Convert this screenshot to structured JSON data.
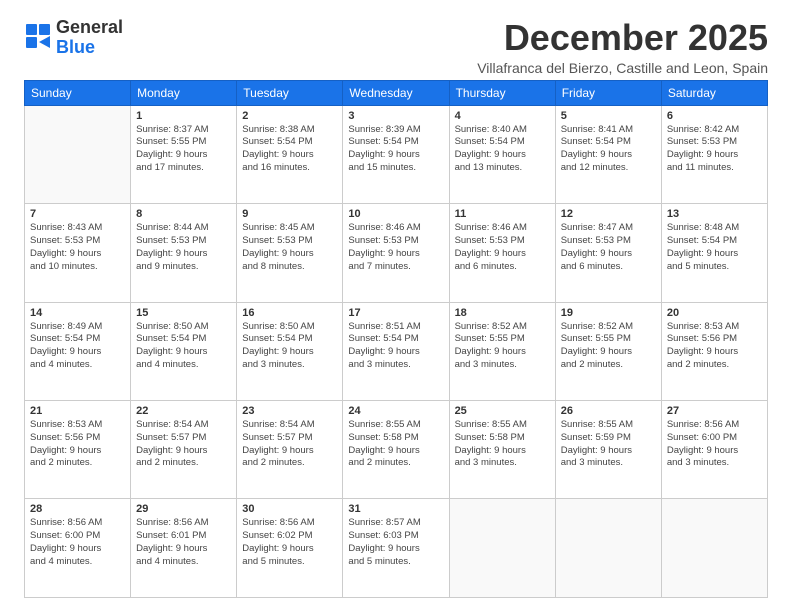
{
  "header": {
    "logo_line1": "General",
    "logo_line2": "Blue",
    "month_title": "December 2025",
    "subtitle": "Villafranca del Bierzo, Castille and Leon, Spain"
  },
  "weekdays": [
    "Sunday",
    "Monday",
    "Tuesday",
    "Wednesday",
    "Thursday",
    "Friday",
    "Saturday"
  ],
  "weeks": [
    [
      {
        "day": "",
        "info": ""
      },
      {
        "day": "1",
        "info": "Sunrise: 8:37 AM\nSunset: 5:55 PM\nDaylight: 9 hours\nand 17 minutes."
      },
      {
        "day": "2",
        "info": "Sunrise: 8:38 AM\nSunset: 5:54 PM\nDaylight: 9 hours\nand 16 minutes."
      },
      {
        "day": "3",
        "info": "Sunrise: 8:39 AM\nSunset: 5:54 PM\nDaylight: 9 hours\nand 15 minutes."
      },
      {
        "day": "4",
        "info": "Sunrise: 8:40 AM\nSunset: 5:54 PM\nDaylight: 9 hours\nand 13 minutes."
      },
      {
        "day": "5",
        "info": "Sunrise: 8:41 AM\nSunset: 5:54 PM\nDaylight: 9 hours\nand 12 minutes."
      },
      {
        "day": "6",
        "info": "Sunrise: 8:42 AM\nSunset: 5:53 PM\nDaylight: 9 hours\nand 11 minutes."
      }
    ],
    [
      {
        "day": "7",
        "info": "Sunrise: 8:43 AM\nSunset: 5:53 PM\nDaylight: 9 hours\nand 10 minutes."
      },
      {
        "day": "8",
        "info": "Sunrise: 8:44 AM\nSunset: 5:53 PM\nDaylight: 9 hours\nand 9 minutes."
      },
      {
        "day": "9",
        "info": "Sunrise: 8:45 AM\nSunset: 5:53 PM\nDaylight: 9 hours\nand 8 minutes."
      },
      {
        "day": "10",
        "info": "Sunrise: 8:46 AM\nSunset: 5:53 PM\nDaylight: 9 hours\nand 7 minutes."
      },
      {
        "day": "11",
        "info": "Sunrise: 8:46 AM\nSunset: 5:53 PM\nDaylight: 9 hours\nand 6 minutes."
      },
      {
        "day": "12",
        "info": "Sunrise: 8:47 AM\nSunset: 5:53 PM\nDaylight: 9 hours\nand 6 minutes."
      },
      {
        "day": "13",
        "info": "Sunrise: 8:48 AM\nSunset: 5:54 PM\nDaylight: 9 hours\nand 5 minutes."
      }
    ],
    [
      {
        "day": "14",
        "info": "Sunrise: 8:49 AM\nSunset: 5:54 PM\nDaylight: 9 hours\nand 4 minutes."
      },
      {
        "day": "15",
        "info": "Sunrise: 8:50 AM\nSunset: 5:54 PM\nDaylight: 9 hours\nand 4 minutes."
      },
      {
        "day": "16",
        "info": "Sunrise: 8:50 AM\nSunset: 5:54 PM\nDaylight: 9 hours\nand 3 minutes."
      },
      {
        "day": "17",
        "info": "Sunrise: 8:51 AM\nSunset: 5:54 PM\nDaylight: 9 hours\nand 3 minutes."
      },
      {
        "day": "18",
        "info": "Sunrise: 8:52 AM\nSunset: 5:55 PM\nDaylight: 9 hours\nand 3 minutes."
      },
      {
        "day": "19",
        "info": "Sunrise: 8:52 AM\nSunset: 5:55 PM\nDaylight: 9 hours\nand 2 minutes."
      },
      {
        "day": "20",
        "info": "Sunrise: 8:53 AM\nSunset: 5:56 PM\nDaylight: 9 hours\nand 2 minutes."
      }
    ],
    [
      {
        "day": "21",
        "info": "Sunrise: 8:53 AM\nSunset: 5:56 PM\nDaylight: 9 hours\nand 2 minutes."
      },
      {
        "day": "22",
        "info": "Sunrise: 8:54 AM\nSunset: 5:57 PM\nDaylight: 9 hours\nand 2 minutes."
      },
      {
        "day": "23",
        "info": "Sunrise: 8:54 AM\nSunset: 5:57 PM\nDaylight: 9 hours\nand 2 minutes."
      },
      {
        "day": "24",
        "info": "Sunrise: 8:55 AM\nSunset: 5:58 PM\nDaylight: 9 hours\nand 2 minutes."
      },
      {
        "day": "25",
        "info": "Sunrise: 8:55 AM\nSunset: 5:58 PM\nDaylight: 9 hours\nand 3 minutes."
      },
      {
        "day": "26",
        "info": "Sunrise: 8:55 AM\nSunset: 5:59 PM\nDaylight: 9 hours\nand 3 minutes."
      },
      {
        "day": "27",
        "info": "Sunrise: 8:56 AM\nSunset: 6:00 PM\nDaylight: 9 hours\nand 3 minutes."
      }
    ],
    [
      {
        "day": "28",
        "info": "Sunrise: 8:56 AM\nSunset: 6:00 PM\nDaylight: 9 hours\nand 4 minutes."
      },
      {
        "day": "29",
        "info": "Sunrise: 8:56 AM\nSunset: 6:01 PM\nDaylight: 9 hours\nand 4 minutes."
      },
      {
        "day": "30",
        "info": "Sunrise: 8:56 AM\nSunset: 6:02 PM\nDaylight: 9 hours\nand 5 minutes."
      },
      {
        "day": "31",
        "info": "Sunrise: 8:57 AM\nSunset: 6:03 PM\nDaylight: 9 hours\nand 5 minutes."
      },
      {
        "day": "",
        "info": ""
      },
      {
        "day": "",
        "info": ""
      },
      {
        "day": "",
        "info": ""
      }
    ]
  ]
}
